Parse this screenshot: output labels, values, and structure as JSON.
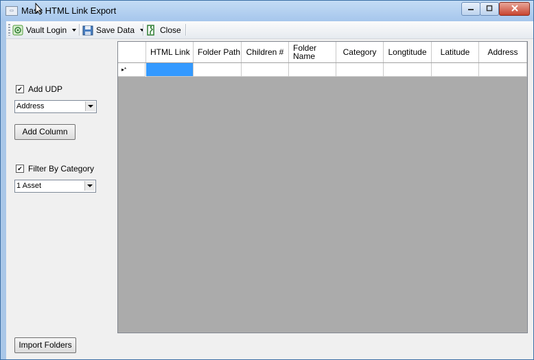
{
  "window": {
    "title": "Mass HTML Link Export"
  },
  "toolbar": {
    "vault_login": "Vault Login",
    "save_data": "Save Data",
    "close": "Close"
  },
  "side": {
    "add_udp_label": "Add UDP",
    "add_udp_checked": true,
    "udp_select": "Address",
    "add_column": "Add Column",
    "filter_label": "Filter By Category",
    "filter_checked": true,
    "category_select": "1 Asset",
    "import_folders": "Import Folders"
  },
  "grid": {
    "columns": [
      "HTML Link",
      "Folder Path",
      "Children #",
      "Folder Name",
      "Category",
      "Longtitude",
      "Latitude",
      "Address"
    ],
    "new_row_marker": "▸*"
  },
  "colors": {
    "selected_cell": "#3399ff",
    "grid_background": "#ababab",
    "title_bar": "#b6d1f0"
  }
}
